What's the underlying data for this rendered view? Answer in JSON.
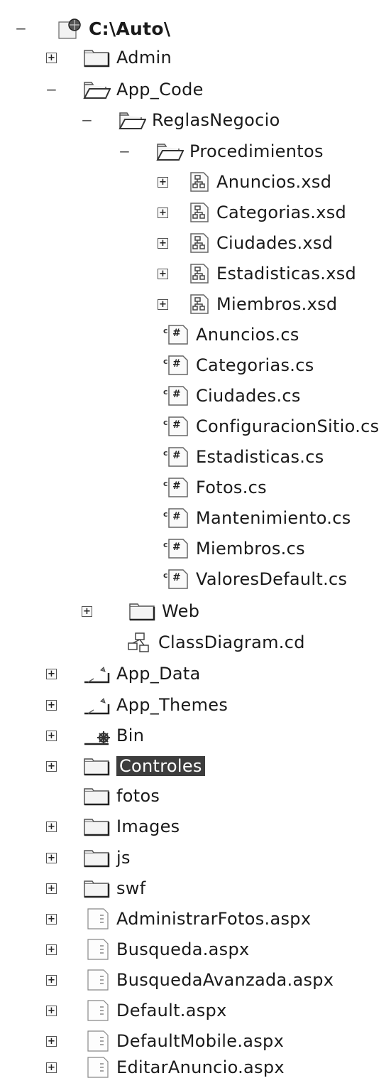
{
  "tree": {
    "root": "C:\\Auto\\",
    "admin": "Admin",
    "app_code": "App_Code",
    "reglas_negocio": "ReglasNegocio",
    "procedimientos": "Procedimientos",
    "xsd_files": [
      "Anuncios.xsd",
      "Categorias.xsd",
      "Ciudades.xsd",
      "Estadisticas.xsd",
      "Miembros.xsd"
    ],
    "cs_files": [
      "Anuncios.cs",
      "Categorias.cs",
      "Ciudades.cs",
      "ConfiguracionSitio.cs",
      "Estadisticas.cs",
      "Fotos.cs",
      "Mantenimiento.cs",
      "Miembros.cs",
      "ValoresDefault.cs"
    ],
    "web": "Web",
    "class_diagram": "ClassDiagram.cd",
    "app_data": "App_Data",
    "app_themes": "App_Themes",
    "bin": "Bin",
    "controles": "Controles",
    "fotos": "fotos",
    "images": "Images",
    "js": "js",
    "swf": "swf",
    "aspx_files": [
      "AdministrarFotos.aspx",
      "Busqueda.aspx",
      "BusquedaAvanzada.aspx",
      "Default.aspx",
      "DefaultMobile.aspx",
      "EditarAnuncio.aspx"
    ]
  },
  "colors": {
    "selection": "#3d3d3d",
    "selection_text": "#ffffff",
    "folder_fill": "#f4f4f4",
    "folder_stroke": "#555555"
  }
}
